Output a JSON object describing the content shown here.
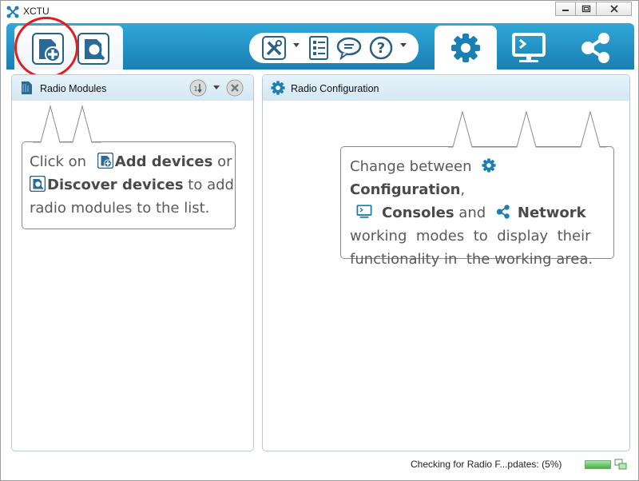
{
  "window": {
    "title": "XCTU"
  },
  "toolbar": {
    "add_devices_icon": "add-device-icon",
    "discover_devices_icon": "discover-device-icon",
    "tools_icon": "tools-icon",
    "profiles_icon": "checklist-icon",
    "feedback_icon": "chat-bubble-icon",
    "help_icon": "question-icon",
    "modes": [
      "configuration-gear-icon",
      "console-monitor-icon",
      "network-nodes-icon"
    ],
    "accent": "#1a8cc4"
  },
  "left_panel": {
    "title": "Radio Modules",
    "callout": {
      "t1": "Click on",
      "add": "Add devices",
      "t2": "or",
      "discover": "Discover devices",
      "t3": "to add",
      "t4": "radio modules to the list."
    }
  },
  "right_panel": {
    "title": "Radio Configuration",
    "callout": {
      "t1": "Change between",
      "config": "Configuration",
      "t2": ",",
      "consoles": "Consoles",
      "t3": "and",
      "network": "Network",
      "t4": "working  modes  to  display  their",
      "t5": "functionality in  the working area."
    }
  },
  "status": {
    "text": "Checking for Radio F...pdates: (5%)",
    "progress": 0.05
  }
}
